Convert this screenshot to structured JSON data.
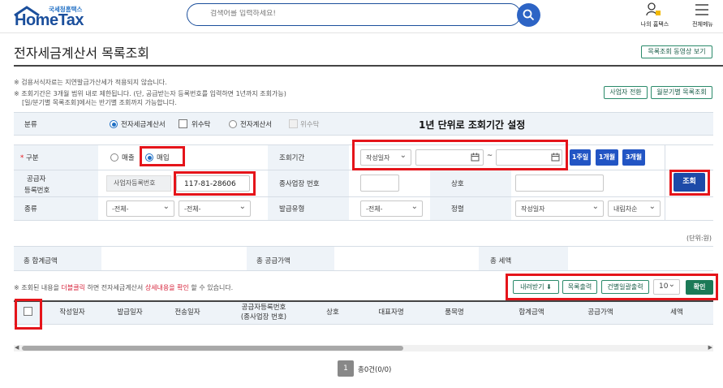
{
  "header": {
    "logo_small": "국세청홈택스",
    "logo_big": "HomeTax",
    "search_placeholder": "검색어를 입력하세요!",
    "my_hometax": "나의 홈택스",
    "all_menu": "전체메뉴"
  },
  "page": {
    "title": "전자세금계산서 목록조회",
    "video_button": "목록조회 동영상 보기",
    "notes": [
      "※ 검용서식자료는 지연발급가산세가 적용되지 않습니다.",
      "※ 조회기간은 3개월 범위 내로 제한됩니다. (단, 공급받는자 등록번호를 입력하면 1년까지 조회가능)",
      "[일/분기별 목록조회]에서는 반기별 조회까지 가능합니다."
    ],
    "biz_switch_button": "사업자 전환",
    "monthly_button": "월분기별 목록조회",
    "annotation": "1년 단위로 조회기간 설정"
  },
  "filter": {
    "type_label": "분류",
    "type_options": [
      "전자세금계산서",
      "위수탁",
      "전자계산서",
      "위수탁"
    ],
    "gubun_label": "구분",
    "gubun_options": [
      "매출",
      "매입"
    ],
    "period_label": "조회기간",
    "period_select": "작성일자",
    "period_sep": "~",
    "period_buttons": [
      "1주일",
      "1개월",
      "3개월"
    ],
    "supplier_label_1": "공급자",
    "supplier_label_2": "등록번호",
    "supplier_select": "사업자등록번호",
    "supplier_value": "117-81-28606",
    "branch_label": "종사업장 번호",
    "company_label": "상호",
    "search_button": "조회",
    "kind_label": "종류",
    "kind_select_1": "-전체-",
    "kind_select_2": "-전체-",
    "issue_type_label": "발급유형",
    "issue_type_select": "-전체-",
    "sort_label": "정렬",
    "sort_select": "작성일자",
    "sort_order_select": "내림차순"
  },
  "summary": {
    "unit": "(단위:원)",
    "total_label": "총 합계금액",
    "supply_label": "총 공급가액",
    "tax_label": "총 세액"
  },
  "results": {
    "note_prefix": "※ 조회된 내용을 ",
    "note_dblclick": "더블클릭",
    "note_mid": " 하면 전자세금계산서 ",
    "note_detail": "상세내용을 확인",
    "note_suffix": " 할 수 있습니다.",
    "download_button": "내려받기",
    "list_print_button": "목록출력",
    "bulk_print_button": "건별일괄출력",
    "page_size": "10",
    "confirm_button": "확인",
    "columns": [
      "작성일자",
      "발급일자",
      "전송일자",
      "공급자등록번호",
      "(종사업장 번호)",
      "상호",
      "대표자명",
      "품목명",
      "합계금액",
      "공급가액",
      "세액"
    ],
    "page_number": "1",
    "total_count": "총0건(0/0)"
  }
}
